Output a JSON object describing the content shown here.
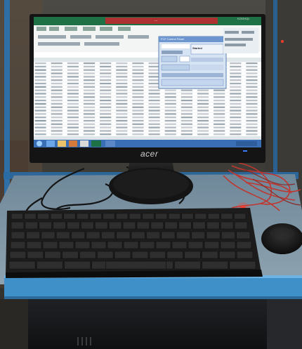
{
  "monitor": {
    "brand": "acer",
    "corner_model": "K202HQL",
    "window_title": "...",
    "dialog_title": "FCF Control Panel",
    "dialog_heading": "Started"
  },
  "colors": {
    "monitor_bezel": "#141414",
    "excel_green": "#1e7145",
    "window_title_red": "#c8262f",
    "taskbar_blue": "#3a6fb5",
    "desk_blue": "#3f8fc8",
    "keyboard": "#1c1c1c",
    "cable_red": "#c0362f",
    "power_led": "#3a7bff"
  },
  "icons": [
    "windows-start-icon",
    "ie-icon",
    "folder-icon",
    "media-icon",
    "chrome-icon",
    "excel-icon",
    "acer-logo"
  ]
}
